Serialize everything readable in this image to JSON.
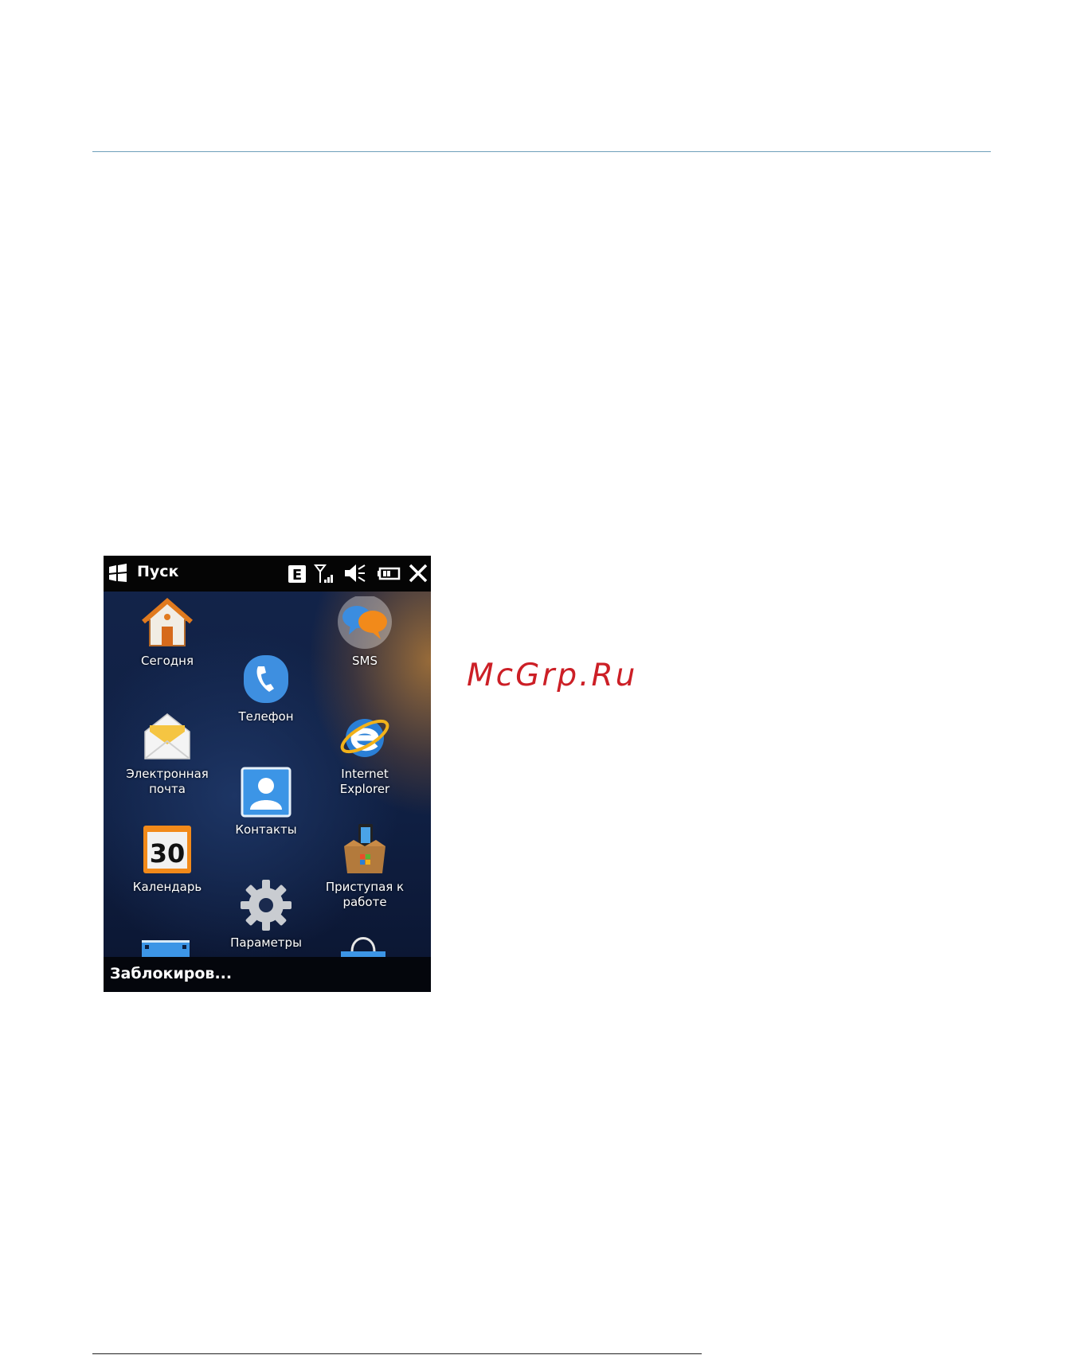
{
  "watermark": "McGrp.Ru",
  "phone": {
    "statusbar": {
      "title": "Пуск",
      "network_badge": "E"
    },
    "tiles": [
      {
        "label": "Сегодня"
      },
      {
        "label": "SMS"
      },
      {
        "label": "Телефон"
      },
      {
        "label": "Электронная"
      },
      {
        "label": "почта"
      },
      {
        "label": "Internet Explorer"
      },
      {
        "label": "Контакты"
      },
      {
        "label": "Календарь"
      },
      {
        "label": "Приступая к"
      },
      {
        "label": "работе"
      },
      {
        "label": "Параметры"
      }
    ],
    "calendar_day": "30",
    "softkey_left": "Заблокиров..."
  },
  "colors": {
    "accent_rule": "#6e9fba",
    "watermark": "#cc1f26",
    "status_bg": "#050505"
  }
}
